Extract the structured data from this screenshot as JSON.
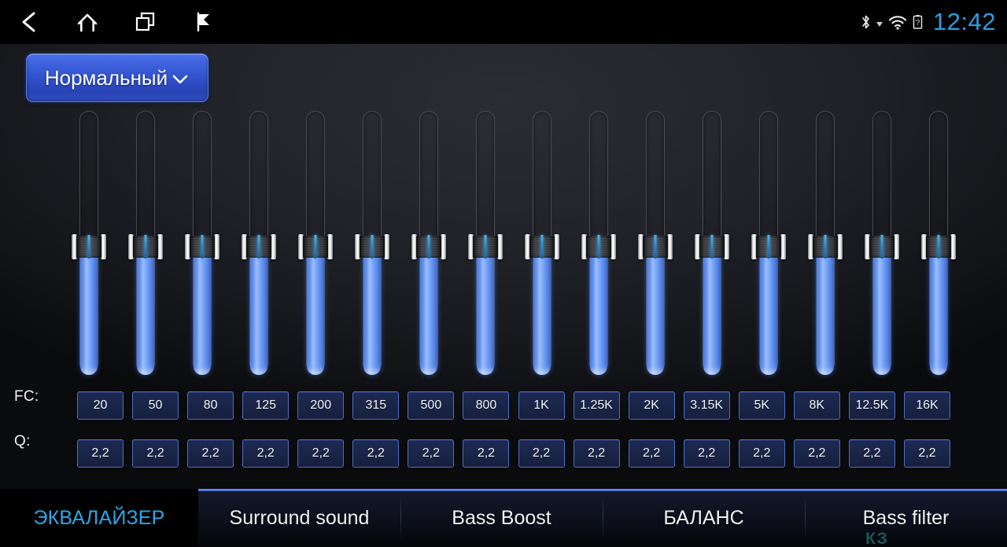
{
  "statusbar": {
    "nav": [
      {
        "name": "back-icon",
        "label": "Back"
      },
      {
        "name": "home-icon",
        "label": "Home"
      },
      {
        "name": "recents-icon",
        "label": "Recent apps"
      },
      {
        "name": "flag-icon",
        "label": "Flag"
      }
    ],
    "icons": [
      {
        "name": "bluetooth-icon",
        "label": "Bluetooth"
      },
      {
        "name": "signal-triangle-icon",
        "label": "Signal"
      },
      {
        "name": "wifi-icon",
        "label": "Wi-Fi"
      },
      {
        "name": "battery-unknown-icon",
        "label": "Battery unknown"
      }
    ],
    "clock": "12:42",
    "clock_color": "#2a9fe0"
  },
  "preset": {
    "label": "Нормальный",
    "caret": "chevron-down-icon",
    "accent": "#3d60dc"
  },
  "rows": {
    "fc_label": "FC:",
    "q_label": "Q:"
  },
  "bands": [
    {
      "fc": "20",
      "q": "2,2",
      "level": 48
    },
    {
      "fc": "50",
      "q": "2,2",
      "level": 48
    },
    {
      "fc": "80",
      "q": "2,2",
      "level": 48
    },
    {
      "fc": "125",
      "q": "2,2",
      "level": 48
    },
    {
      "fc": "200",
      "q": "2,2",
      "level": 48
    },
    {
      "fc": "315",
      "q": "2,2",
      "level": 48
    },
    {
      "fc": "500",
      "q": "2,2",
      "level": 48
    },
    {
      "fc": "800",
      "q": "2,2",
      "level": 48
    },
    {
      "fc": "1K",
      "q": "2,2",
      "level": 48
    },
    {
      "fc": "1.25K",
      "q": "2,2",
      "level": 48
    },
    {
      "fc": "2K",
      "q": "2,2",
      "level": 48
    },
    {
      "fc": "3.15K",
      "q": "2,2",
      "level": 48
    },
    {
      "fc": "5K",
      "q": "2,2",
      "level": 48
    },
    {
      "fc": "8K",
      "q": "2,2",
      "level": 48
    },
    {
      "fc": "12.5K",
      "q": "2,2",
      "level": 48
    },
    {
      "fc": "16K",
      "q": "2,2",
      "level": 48
    }
  ],
  "tabs": [
    {
      "label": "ЭКВАЛАЙЗЕР",
      "active": true
    },
    {
      "label": "Surround sound",
      "active": false
    },
    {
      "label": "Bass Boost",
      "active": false
    },
    {
      "label": "БАЛАНС",
      "active": false
    },
    {
      "label": "Bass filter",
      "active": false
    }
  ],
  "watermark": "КЗ",
  "colors": {
    "accent_blue": "#29a8e8",
    "slider_blue": "#7ea9f7",
    "cell_border": "#4f6fc4",
    "background": "#212328"
  }
}
